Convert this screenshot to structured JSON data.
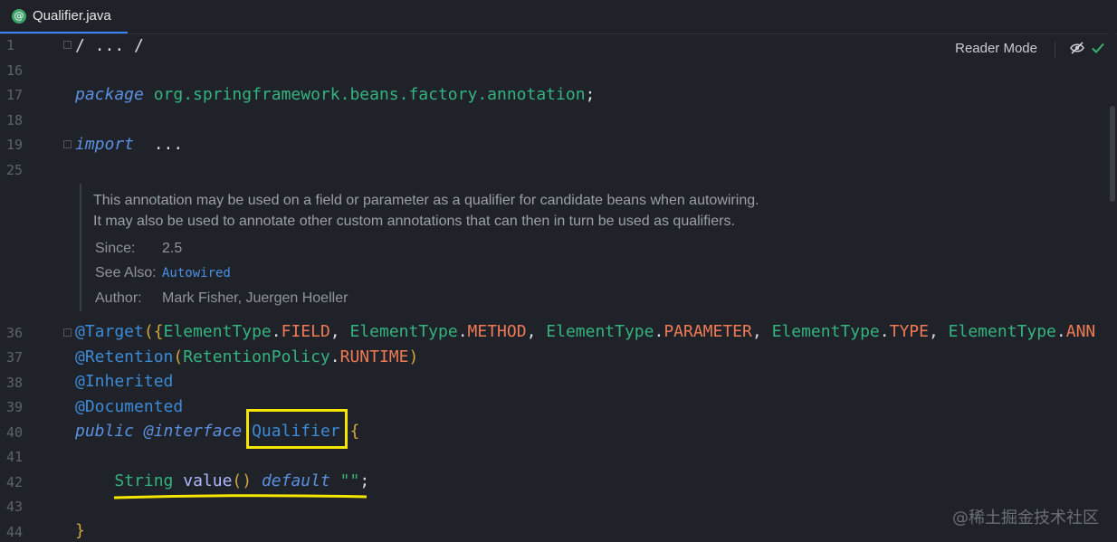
{
  "tab": {
    "icon": "@",
    "label": "Qualifier.java"
  },
  "reader_mode": {
    "label": "Reader Mode"
  },
  "gutter": {
    "lines": [
      "1",
      "16",
      "17",
      "18",
      "19",
      "25",
      "36",
      "37",
      "38",
      "39",
      "40",
      "41",
      "42",
      "43",
      "44"
    ]
  },
  "code": {
    "line1_text": "/ ... /",
    "package_kw": "package",
    "package_name": "org.springframework.beans.factory.annotation",
    "package_semicolon": ";",
    "import_kw": "import",
    "import_rest": "...",
    "target": {
      "at_target": "@Target",
      "open": "({",
      "t1_type": "ElementType",
      "t1_const": "FIELD",
      "t2_type": "ElementType",
      "t2_const": "METHOD",
      "t3_type": "ElementType",
      "t3_const": "PARAMETER",
      "t4_type": "ElementType",
      "t4_const": "TYPE",
      "t5_type": "ElementType",
      "t5_const": "ANN"
    },
    "retention": {
      "at_retention": "@Retention",
      "open": "(",
      "policy_type": "RetentionPolicy",
      "policy_const": "RUNTIME",
      "close": ")"
    },
    "inherited": "@Inherited",
    "documented": "@Documented",
    "decl": {
      "public_kw": "public",
      "at_interface": "@interface",
      "name": "Qualifier",
      "open_brace": "{"
    },
    "method": {
      "ret_type": "String",
      "name": "value",
      "parens": "()",
      "default_kw": "default",
      "default_val": "\"\"",
      "semicolon": ";"
    },
    "close_brace": "}"
  },
  "doc": {
    "line1": "This annotation may be used on a field or parameter as a qualifier for candidate beans when autowiring.",
    "line2": "It may also be used to annotate other custom annotations that can then in turn be used as qualifiers.",
    "since_label": "Since:",
    "since_value": "2.5",
    "see_also_label": "See Also:",
    "see_also_link": "Autowired",
    "author_label": "Author:",
    "author_value": "Mark Fisher, Juergen Hoeller"
  },
  "watermark": "@稀土掘金技术社区",
  "colors": {
    "highlight": "#f4e600",
    "keyword": "#5c8fdf",
    "annotation": "#3d8ad6",
    "class": "#35b37f",
    "constant": "#ef7a55"
  }
}
